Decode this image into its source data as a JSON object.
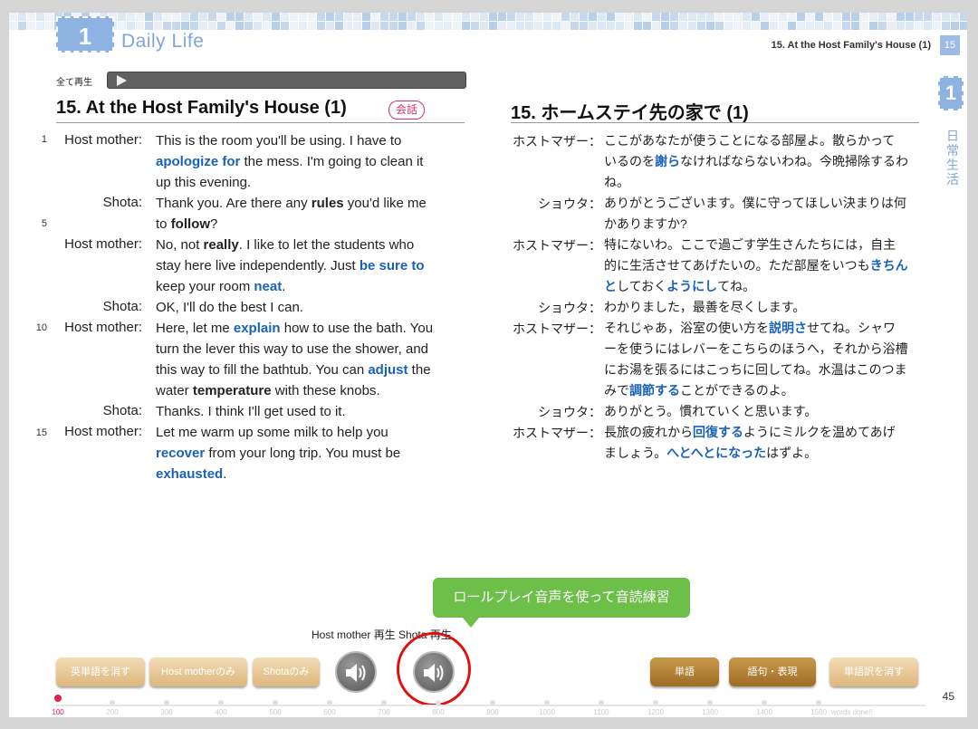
{
  "header": {
    "chapter_num": "1",
    "chapter_title": "Daily Life",
    "right_title": "15. At the Host Family's House (1)",
    "page_tab": "15",
    "side_tab_num": "1",
    "side_tab_label": "日常生活"
  },
  "play_all_label": "全て再生",
  "english": {
    "title": "15. At the Host Family's House (1)",
    "badge": "会話",
    "line_numbers": [
      "1",
      "5",
      "10",
      "15"
    ]
  },
  "japanese": {
    "title": "15. ホームステイ先の家で (1)"
  },
  "dialogue_en": [
    {
      "speaker": "Host mother:",
      "html": "This is the room you'll be using. I have to<br><span class='kw'>apologize for</span> the mess. I'm going to clean it<br>up this evening."
    },
    {
      "speaker": "Shota:",
      "html": "Thank you. Are there any <span class='b'>rules</span> you'd like me<br>to <span class='b'>follow</span>?"
    },
    {
      "speaker": "Host mother:",
      "html": "No, not <span class='b'>really</span>. I like to let the students who<br>stay here live independently. Just <span class='kw'>be sure to</span><br>keep your room <span class='kw'>neat</span>."
    },
    {
      "speaker": "Shota:",
      "html": "OK, I'll do the best I can."
    },
    {
      "speaker": "Host mother:",
      "html": "Here, let me <span class='kw'>explain</span> how to use the bath. You<br>turn the lever this way to use the shower, and<br>this way to fill the bathtub. You can <span class='kw'>adjust</span> the<br>water <span class='b'>temperature</span> with these knobs."
    },
    {
      "speaker": "Shota:",
      "html": "Thanks. I think I'll get used to it."
    },
    {
      "speaker": "Host mother:",
      "html": "Let me warm up some milk to help you<br><span class='kw'>recover</span> from your long trip. You must be<br><span class='kw'>exhausted</span>."
    }
  ],
  "dialogue_jp": [
    {
      "speaker": "ホストマザー：",
      "html": "ここがあなたが使うことになる部屋よ。散らかって<br>いるのを<span class='kw'>謝ら</span>なければならないわね。今晩掃除するわ<br>ね。"
    },
    {
      "speaker": "ショウタ：",
      "html": "ありがとうございます。僕に守ってほしい決まりは何<br>かありますか?"
    },
    {
      "speaker": "ホストマザー：",
      "html": "特にないわ。ここで過ごす学生さんたちには，自主<br>的に生活させてあげたいの。ただ部屋をいつも<span class='kw'>きちん</span><br><span class='kw'>と</span>しておく<span class='kw'>ようにし</span>てね。"
    },
    {
      "speaker": "ショウタ：",
      "html": "わかりました，最善を尽くします。"
    },
    {
      "speaker": "ホストマザー：",
      "html": "それじゃあ，浴室の使い方を<span class='kw'>説明さ</span>せてね。シャワ<br>ーを使うにはレバーをこちらのほうへ，それから浴槽<br>にお湯を張るにはこっちに回してね。水温はこのつま<br>みで<span class='kw'>調節する</span>ことができるのよ。"
    },
    {
      "speaker": "ショウタ：",
      "html": "ありがとう。慣れていくと思います。"
    },
    {
      "speaker": "ホストマザー：",
      "html": "長旅の疲れから<span class='kw'>回復する</span>ようにミルクを温めてあげ<br>ましょう。<span class='kw'>へとへとになった</span>はずよ。"
    }
  ],
  "tooltip": "ロールプレイ音声を使って音読練習",
  "play_caption": "Host mother 再生 Shota 再生",
  "buttons": {
    "hide_english": "英単語を消す",
    "host_only": "Host motherのみ",
    "shota_only": "Shotaのみ",
    "vocab": "単語",
    "phrases": "語句・表現",
    "hide_translation": "単語訳を消す"
  },
  "page_number": "45",
  "progress": {
    "ticks": [
      "100",
      "200",
      "300",
      "400",
      "500",
      "600",
      "700",
      "800",
      "900",
      "1000",
      "1100",
      "1200",
      "1300",
      "1400",
      "1500"
    ],
    "suffix": "words done!!"
  },
  "colors": {
    "accent_blue": "#1a62b8",
    "chapter_blue": "#8eb3e2",
    "tooltip_green": "#6cc04a",
    "highlight_red": "#e01010"
  }
}
